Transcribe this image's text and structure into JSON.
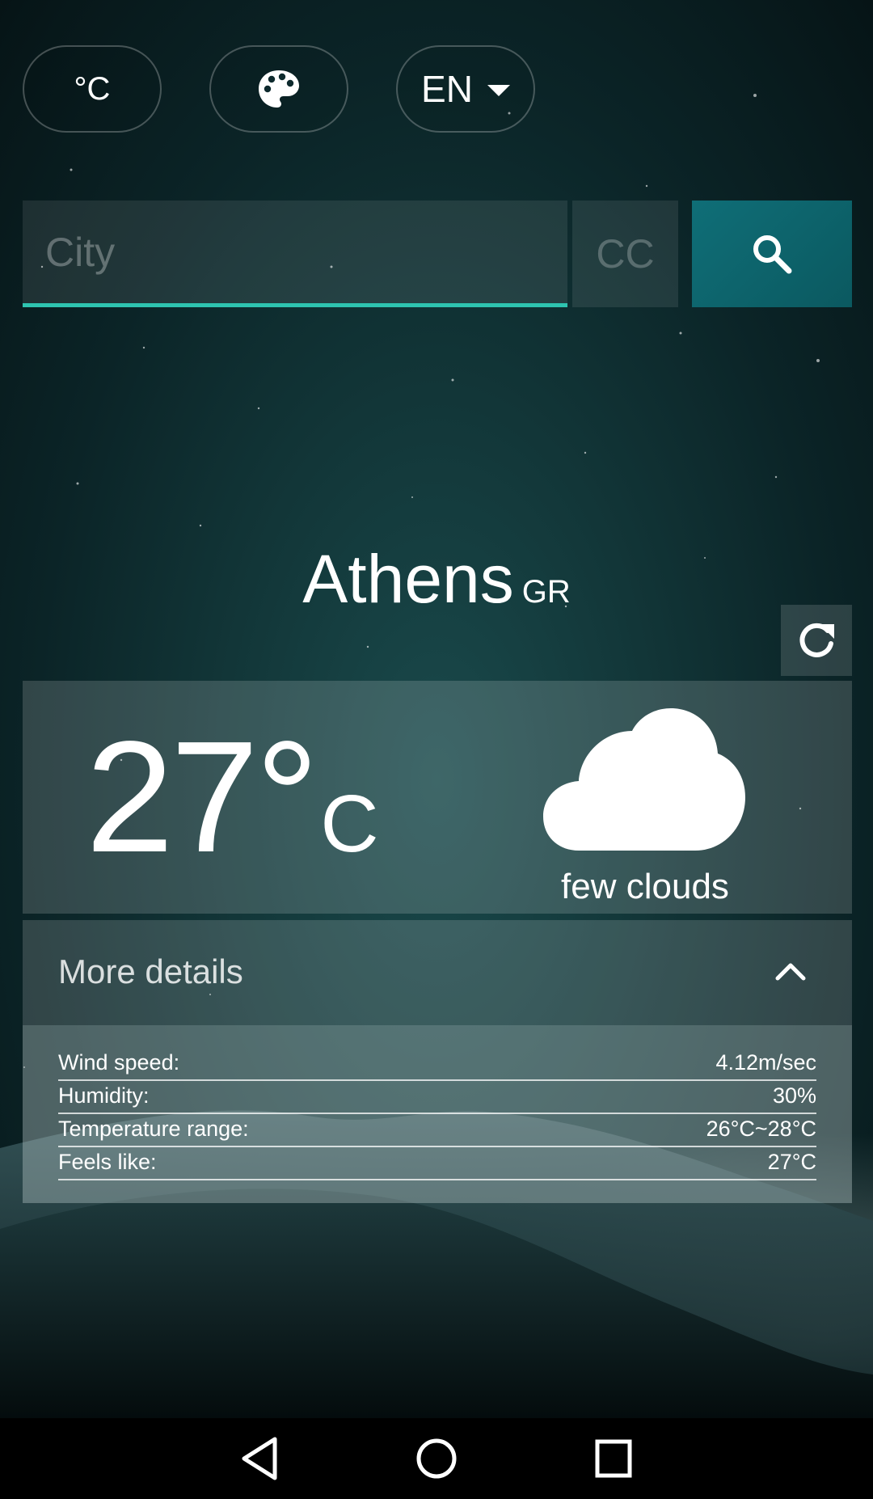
{
  "toolbar": {
    "unit_label": "°C",
    "language_label": "EN",
    "theme_icon": "palette-icon"
  },
  "search": {
    "city_placeholder": "City",
    "country_placeholder": "CC",
    "search_icon": "search-icon"
  },
  "location": {
    "city": "Athens",
    "country_code": "GR"
  },
  "weather": {
    "temperature": "27°",
    "unit": "C",
    "condition": "few clouds",
    "condition_icon": "cloud-icon"
  },
  "details": {
    "title": "More details",
    "rows": [
      {
        "label": "Wind speed:",
        "value": "4.12m/sec"
      },
      {
        "label": "Humidity:",
        "value": "30%"
      },
      {
        "label": "Temperature range:",
        "value": "26°C~28°C"
      },
      {
        "label": "Feels like:",
        "value": "27°C"
      }
    ]
  },
  "colors": {
    "accent": "#2ec4b0",
    "search_button": "#0f6e77",
    "background": "#0b2427"
  }
}
